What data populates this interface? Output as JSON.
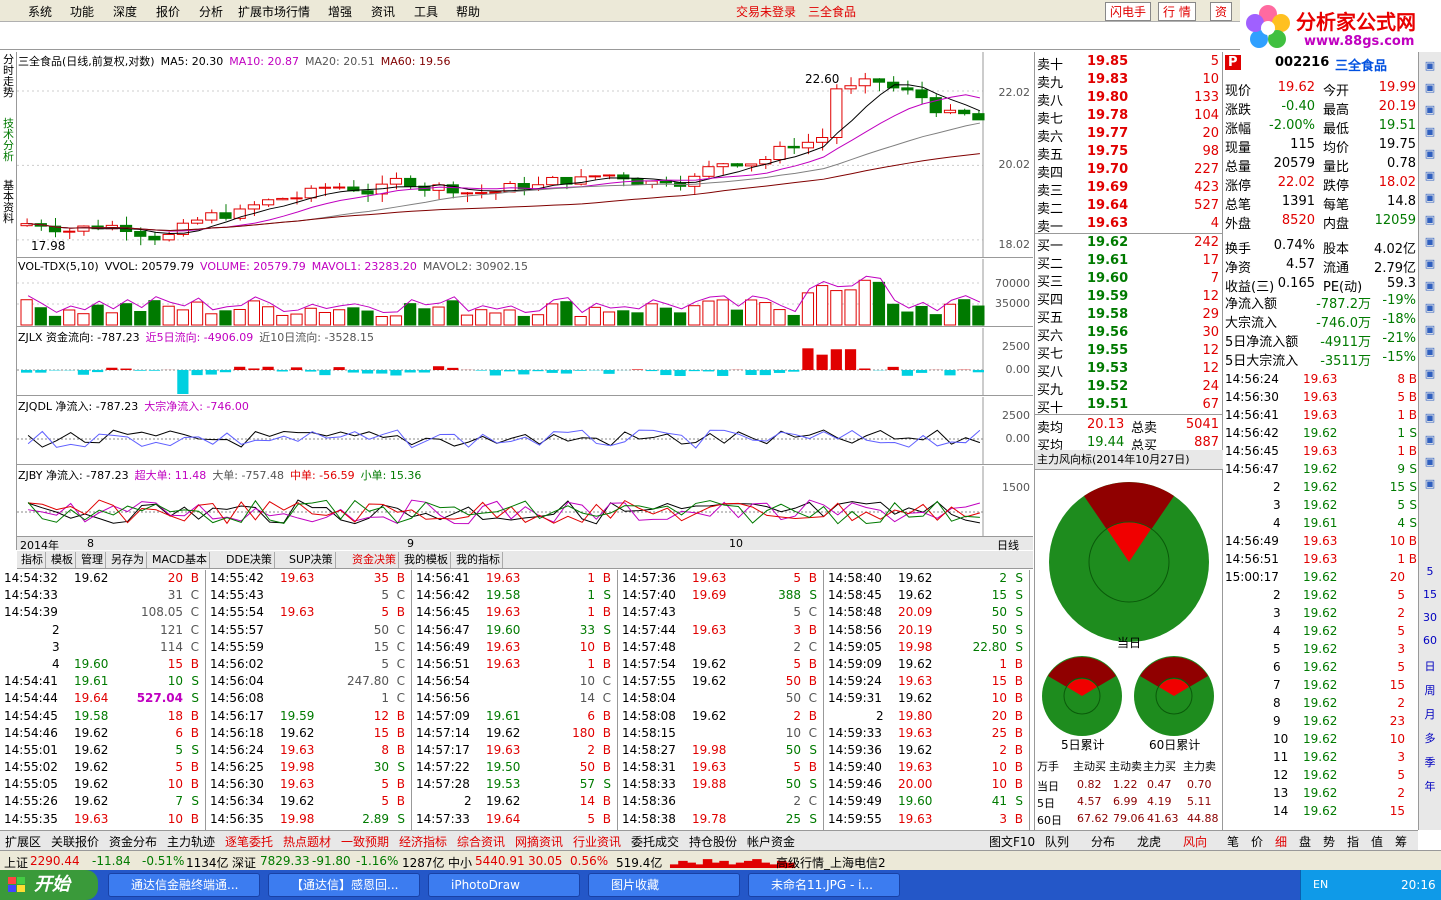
{
  "menu": [
    "系统",
    "功能",
    "深度",
    "报价",
    "分析",
    "扩展市场行情",
    "增强",
    "资讯",
    "工具",
    "帮助"
  ],
  "status": {
    "login": "交易未登录",
    "stock": "三全食品"
  },
  "top_buttons": [
    "闪电手",
    "行 情",
    "资"
  ],
  "logo": {
    "name": "分析家公式网",
    "url": "www.88gs.com"
  },
  "vtabs": [
    "分时走势",
    "技术分析",
    "基本资料"
  ],
  "kline": {
    "title": "三全食品(日线,前复权,对数)",
    "ma5": "MA5: 20.30",
    "ma10": "MA10: 20.87",
    "ma20": "MA20: 20.51",
    "ma60": "MA60: 19.56",
    "y": [
      "22.02",
      "20.02",
      "18.02"
    ],
    "hi": "22.60",
    "lo": "17.98"
  },
  "vol": {
    "title": "VOL-TDX(5,10)",
    "v1": "VVOL: 20579.79",
    "v2": "VOLUME: 20579.79",
    "v3": "MAVOL1: 23283.20",
    "v4": "MAVOL2: 30902.15",
    "y": [
      "70000",
      "35000"
    ]
  },
  "zjlx": {
    "title": "ZJLX 资金流向: -787.23",
    "a": "近5日流向: -4906.09",
    "b": "近10日流向: -3528.15",
    "y": [
      "2500",
      "0.00"
    ]
  },
  "zjqdl": {
    "title": "ZJQDL 净流入: -787.23",
    "a": "大宗净流入: -746.00",
    "y": [
      "2500",
      "0.00"
    ]
  },
  "zjby": {
    "title": "ZJBY 净流入: -787.23",
    "a": "超大单: 11.48",
    "b": "大单: -757.48",
    "c": "中单: -56.59",
    "d": "小单: 15.36",
    "y": [
      "1500"
    ]
  },
  "xaxis": {
    "year": "2014年",
    "labels": [
      "8",
      "9",
      "10"
    ],
    "period": "日线"
  },
  "btabs": [
    "指标",
    "模板",
    "管理",
    "另存为",
    "MACD基本",
    "DDE决策",
    "SUP决策",
    "资金决策",
    "我的模板",
    "我的指标"
  ],
  "ticks": [
    [
      [
        "14:54:32",
        "19.62",
        "20",
        "B"
      ],
      [
        "14:54:33",
        "",
        "31",
        "C"
      ],
      [
        "14:54:39",
        "",
        "108.05",
        "C"
      ],
      [
        "2",
        "",
        "121",
        "C"
      ],
      [
        "3",
        "",
        "114",
        "C"
      ],
      [
        "4",
        "19.60",
        "15",
        "B"
      ],
      [
        "14:54:41",
        "19.61",
        "10",
        "S"
      ],
      [
        "14:54:44",
        "19.64",
        "527.04",
        "S"
      ],
      [
        "14:54:45",
        "19.58",
        "18",
        "B"
      ],
      [
        "14:54:46",
        "19.62",
        "6",
        "B"
      ],
      [
        "14:55:01",
        "19.62",
        "5",
        "S"
      ],
      [
        "14:55:02",
        "19.62",
        "5",
        "B"
      ],
      [
        "14:55:05",
        "19.62",
        "10",
        "B"
      ],
      [
        "14:55:26",
        "19.62",
        "7",
        "S"
      ],
      [
        "14:55:35",
        "19.63",
        "10",
        "B"
      ]
    ],
    [
      [
        "14:55:42",
        "19.63",
        "35",
        "B"
      ],
      [
        "14:55:43",
        "",
        "5",
        "C"
      ],
      [
        "14:55:54",
        "19.63",
        "5",
        "B"
      ],
      [
        "14:55:57",
        "",
        "50",
        "C"
      ],
      [
        "14:55:59",
        "",
        "15",
        "C"
      ],
      [
        "14:56:02",
        "",
        "5",
        "C"
      ],
      [
        "14:56:04",
        "",
        "247.80",
        "C"
      ],
      [
        "14:56:08",
        "",
        "1",
        "C"
      ],
      [
        "14:56:17",
        "19.59",
        "12",
        "B"
      ],
      [
        "14:56:18",
        "19.62",
        "15",
        "B"
      ],
      [
        "14:56:24",
        "19.63",
        "8",
        "B"
      ],
      [
        "14:56:25",
        "19.98",
        "30",
        "S"
      ],
      [
        "14:56:30",
        "19.63",
        "5",
        "B"
      ],
      [
        "14:56:34",
        "19.62",
        "5",
        "B"
      ],
      [
        "14:56:35",
        "19.98",
        "2.89",
        "S"
      ]
    ],
    [
      [
        "14:56:41",
        "19.63",
        "1",
        "B"
      ],
      [
        "14:56:42",
        "19.58",
        "1",
        "S"
      ],
      [
        "14:56:45",
        "19.63",
        "1",
        "B"
      ],
      [
        "14:56:47",
        "19.60",
        "33",
        "S"
      ],
      [
        "14:56:49",
        "19.63",
        "10",
        "B"
      ],
      [
        "14:56:51",
        "19.63",
        "1",
        "B"
      ],
      [
        "14:56:54",
        "",
        "10",
        "C"
      ],
      [
        "14:56:56",
        "",
        "14",
        "C"
      ],
      [
        "14:57:09",
        "19.61",
        "6",
        "B"
      ],
      [
        "14:57:14",
        "19.62",
        "180",
        "B"
      ],
      [
        "14:57:17",
        "19.63",
        "2",
        "B"
      ],
      [
        "14:57:22",
        "19.50",
        "50",
        "B"
      ],
      [
        "14:57:28",
        "19.53",
        "57",
        "S"
      ],
      [
        "2",
        "19.62",
        "14",
        "B"
      ],
      [
        "14:57:33",
        "19.64",
        "5",
        "B"
      ]
    ],
    [
      [
        "14:57:36",
        "19.63",
        "5",
        "B"
      ],
      [
        "14:57:40",
        "19.69",
        "388",
        "S"
      ],
      [
        "14:57:43",
        "",
        "5",
        "C"
      ],
      [
        "14:57:44",
        "19.63",
        "3",
        "B"
      ],
      [
        "14:57:48",
        "",
        "2",
        "C"
      ],
      [
        "14:57:54",
        "19.62",
        "5",
        "B"
      ],
      [
        "14:57:55",
        "19.62",
        "50",
        "B"
      ],
      [
        "14:58:04",
        "",
        "50",
        "C"
      ],
      [
        "14:58:08",
        "19.62",
        "2",
        "B"
      ],
      [
        "14:58:15",
        "",
        "10",
        "C"
      ],
      [
        "14:58:27",
        "19.98",
        "50",
        "S"
      ],
      [
        "14:58:31",
        "19.63",
        "5",
        "B"
      ],
      [
        "14:58:33",
        "19.88",
        "50",
        "S"
      ],
      [
        "14:58:36",
        "",
        "2",
        "C"
      ],
      [
        "14:58:38",
        "19.78",
        "25",
        "S"
      ]
    ],
    [
      [
        "14:58:40",
        "19.62",
        "2",
        "S"
      ],
      [
        "14:58:45",
        "19.62",
        "15",
        "S"
      ],
      [
        "14:58:48",
        "20.09",
        "50",
        "S"
      ],
      [
        "14:58:56",
        "20.19",
        "50",
        "S"
      ],
      [
        "14:59:05",
        "19.98",
        "22.80",
        "S"
      ],
      [
        "14:59:09",
        "19.62",
        "1",
        "B"
      ],
      [
        "14:59:24",
        "19.63",
        "15",
        "B"
      ],
      [
        "14:59:31",
        "19.62",
        "10",
        "B"
      ],
      [
        "2",
        "19.80",
        "20",
        "B"
      ],
      [
        "14:59:33",
        "19.63",
        "25",
        "B"
      ],
      [
        "14:59:36",
        "19.62",
        "2",
        "B"
      ],
      [
        "14:59:40",
        "19.63",
        "10",
        "B"
      ],
      [
        "14:59:46",
        "20.00",
        "10",
        "B"
      ],
      [
        "14:59:49",
        "19.60",
        "41",
        "S"
      ],
      [
        "14:59:55",
        "19.63",
        "3",
        "B"
      ]
    ]
  ],
  "orderbook": {
    "sell": [
      [
        "卖十",
        "19.85",
        "5"
      ],
      [
        "卖九",
        "19.83",
        "10"
      ],
      [
        "卖八",
        "19.80",
        "133"
      ],
      [
        "卖七",
        "19.78",
        "104"
      ],
      [
        "卖六",
        "19.77",
        "20"
      ],
      [
        "卖五",
        "19.75",
        "98"
      ],
      [
        "卖四",
        "19.70",
        "227"
      ],
      [
        "卖三",
        "19.69",
        "423"
      ],
      [
        "卖二",
        "19.64",
        "527"
      ],
      [
        "卖一",
        "19.63",
        "4"
      ]
    ],
    "buy": [
      [
        "买一",
        "19.62",
        "242"
      ],
      [
        "买二",
        "19.61",
        "17"
      ],
      [
        "买三",
        "19.60",
        "7"
      ],
      [
        "买四",
        "19.59",
        "12"
      ],
      [
        "买五",
        "19.58",
        "29"
      ],
      [
        "买六",
        "19.56",
        "30"
      ],
      [
        "买七",
        "19.55",
        "12"
      ],
      [
        "买八",
        "19.53",
        "12"
      ],
      [
        "买九",
        "19.52",
        "24"
      ],
      [
        "买十",
        "19.51",
        "67"
      ]
    ],
    "avg": [
      [
        "卖均",
        "20.13",
        "总卖",
        "5041"
      ],
      [
        "买均",
        "19.44",
        "总买",
        "887"
      ]
    ]
  },
  "quote": {
    "code": "002216",
    "name": "三全食品",
    "rows": [
      [
        "现价",
        "19.62",
        "今开",
        "19.99"
      ],
      [
        "涨跌",
        "-0.40",
        "最高",
        "20.19"
      ],
      [
        "涨幅",
        "-2.00%",
        "最低",
        "19.51"
      ],
      [
        "现量",
        "115",
        "均价",
        "19.75"
      ],
      [
        "总量",
        "20579",
        "量比",
        "0.78"
      ],
      [
        "涨停",
        "22.02",
        "跌停",
        "18.02"
      ],
      [
        "总笔",
        "1391",
        "每笔",
        "14.8"
      ],
      [
        "外盘",
        "8520",
        "内盘",
        "12059"
      ],
      [
        "换手",
        "0.74%",
        "股本",
        "4.02亿"
      ],
      [
        "净资",
        "4.57",
        "流通",
        "2.79亿"
      ],
      [
        "收益(三)",
        "0.165",
        "PE(动)",
        "59.3"
      ]
    ],
    "flows": [
      [
        "净流入额",
        "-787.2万",
        "-19%"
      ],
      [
        "大宗流入",
        "-746.0万",
        "-18%"
      ],
      [
        "5日净流入额",
        "-4911万",
        "-21%"
      ],
      [
        "5日大宗流入",
        "-3511万",
        "-15%"
      ]
    ]
  },
  "tlist": [
    [
      "14:56:24",
      "19.63",
      "8",
      "B"
    ],
    [
      "14:56:30",
      "19.63",
      "5",
      "B"
    ],
    [
      "14:56:41",
      "19.63",
      "1",
      "B"
    ],
    [
      "14:56:42",
      "19.62",
      "1",
      "S"
    ],
    [
      "14:56:45",
      "19.63",
      "1",
      "B"
    ],
    [
      "14:56:47",
      "19.62",
      "9",
      "S"
    ],
    [
      "2",
      "19.62",
      "15",
      "S"
    ],
    [
      "3",
      "19.62",
      "5",
      "S"
    ],
    [
      "4",
      "19.61",
      "4",
      "S"
    ],
    [
      "14:56:49",
      "19.63",
      "10",
      "B"
    ],
    [
      "14:56:51",
      "19.63",
      "1",
      "B"
    ],
    [
      "15:00:17",
      "19.62",
      "20",
      ""
    ],
    [
      "2",
      "19.62",
      "5",
      ""
    ],
    [
      "3",
      "19.62",
      "2",
      ""
    ],
    [
      "4",
      "19.62",
      "5",
      ""
    ],
    [
      "5",
      "19.62",
      "3",
      ""
    ],
    [
      "6",
      "19.62",
      "5",
      ""
    ],
    [
      "7",
      "19.62",
      "15",
      ""
    ],
    [
      "8",
      "19.62",
      "2",
      ""
    ],
    [
      "9",
      "19.62",
      "23",
      ""
    ],
    [
      "10",
      "19.62",
      "10",
      ""
    ],
    [
      "11",
      "19.62",
      "3",
      ""
    ],
    [
      "12",
      "19.62",
      "5",
      ""
    ],
    [
      "13",
      "19.62",
      "2",
      ""
    ],
    [
      "14",
      "19.62",
      "15",
      ""
    ]
  ],
  "rtoolbar": [
    "日",
    "周",
    "月",
    "多",
    "季",
    "年"
  ],
  "rtoolbar_nums": [
    "5",
    "15",
    "30",
    "60"
  ],
  "wind": {
    "title": "主力风向标(2014年10月27日)",
    "today": "当日",
    "d5": "5日累计",
    "d60": "60日累计"
  },
  "flowtable": {
    "head": [
      "万手",
      "主动买",
      "主动卖",
      "主力买",
      "主力卖"
    ],
    "rows": [
      [
        "当日",
        "0.82",
        "1.22",
        "0.47",
        "0.70"
      ],
      [
        "5日",
        "4.57",
        "6.99",
        "4.19",
        "5.11"
      ],
      [
        "60日",
        "67.62",
        "79.06",
        "41.63",
        "44.88"
      ]
    ]
  },
  "bottomtabs": [
    "扩展区",
    "关联报价",
    "资金分布",
    "主力轨迹",
    "逐笔委托",
    "热点题材",
    "一致预期",
    "经济指标",
    "综合资讯",
    "网摘资讯",
    "行业资讯",
    "委托成交",
    "持仓股份",
    "帐户资金",
    "图文F10"
  ],
  "rbtabs": [
    "队列",
    "分布",
    "龙虎",
    "风向"
  ],
  "rbtabs2": [
    "笔",
    "价",
    "细",
    "盘",
    "势",
    "指",
    "值",
    "筹"
  ],
  "indexbar": {
    "sh": "上证",
    "sh_v": "2290.44",
    "sh_c": "-11.84",
    "sh_p": "-0.51%",
    "sh_a": "1134亿",
    "sz": "深证",
    "sz_v": "7829.33",
    "sz_c": "-91.80",
    "sz_p": "-1.16%",
    "sz_a": "1287亿",
    "zx": "中小",
    "zx_v": "5440.91",
    "zx_c": "30.05",
    "zx_p": "0.56%",
    "zx_a": "519.4亿",
    "hq": "高级行情_上海电信2"
  },
  "taskbar": {
    "start": "开始",
    "tasks": [
      "通达信金融终端通...",
      "【通达信】感恩回...",
      "iPhotoDraw",
      "图片收藏",
      "未命名11.JPG - i..."
    ],
    "lang": "EN",
    "time": "20:16"
  },
  "colors": {
    "up": "#e00000",
    "down": "#007a00",
    "ma5": "#000000",
    "ma10": "#c000c0",
    "ma20": "#808080",
    "ma60": "#800000",
    "cyan": "#00d0e0"
  }
}
